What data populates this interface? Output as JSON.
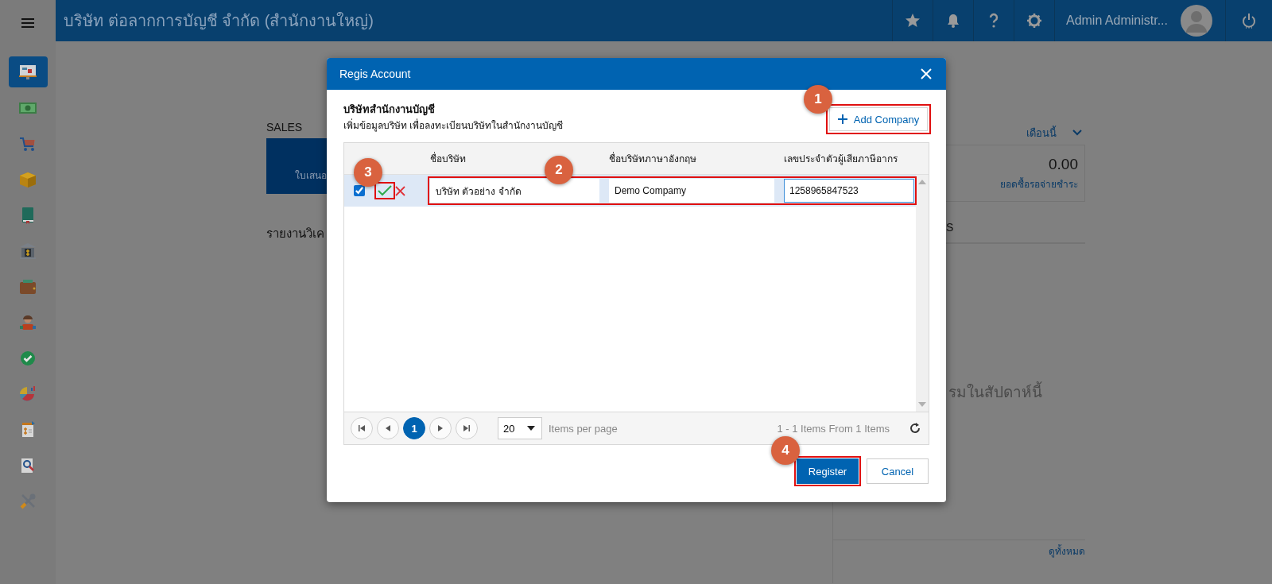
{
  "app_bar": {
    "title": "บริษัท ต่อลากการบัญชี จำกัด (สำนักงานใหญ่)",
    "user_name": "Admin Administr..."
  },
  "sidebar": {
    "items": [
      {
        "kind": "monitor",
        "selected": true
      },
      {
        "kind": "money",
        "selected": false
      },
      {
        "kind": "cart",
        "selected": false
      },
      {
        "kind": "box",
        "selected": false
      },
      {
        "kind": "book",
        "selected": false
      },
      {
        "kind": "bank",
        "selected": false
      },
      {
        "kind": "wallet",
        "selected": false
      },
      {
        "kind": "people",
        "selected": false
      },
      {
        "kind": "check",
        "selected": false
      },
      {
        "kind": "chart",
        "selected": false
      },
      {
        "kind": "invoice",
        "selected": false
      },
      {
        "kind": "search",
        "selected": false
      },
      {
        "kind": "tools",
        "selected": false
      }
    ]
  },
  "background": {
    "sales_label": "SALES",
    "tile_label": "ใบเสนอ",
    "report_heading": "รายงานวิเค",
    "period": "เดือนนี้",
    "stats": [
      {
        "value": "0.00",
        "label": "ยอดซื้อรอจ่ายชำระ"
      }
    ],
    "section_label": "S",
    "empty_message": "รมในสัปดาห์นี้",
    "view_all": "ดูทั้งหมด"
  },
  "dialog": {
    "title": "Regis Account",
    "heading": "บริษัทสำนักงานบัญชี",
    "subtitle": "เพิ่มข้อมูลบริษัท เพื่อลงทะเบียนบริษัทในสำนักงานบัญชี",
    "add_button": "Add Company",
    "table": {
      "columns": [
        "ชื่อบริษัท",
        "ชื่อบริษัทภาษาอังกฤษ",
        "เลขประจำตัวผู้เสียภาษีอากร"
      ],
      "rows": [
        {
          "checked": true,
          "selected": true,
          "cells": [
            {
              "value": "บริษัท ตัวอย่าง จำกัด",
              "focused": false
            },
            {
              "value": "Demo Compamy",
              "focused": false
            },
            {
              "value": "1258965847523",
              "focused": true
            }
          ]
        }
      ]
    },
    "pager": {
      "pages": [
        {
          "label": "1",
          "selected": true
        }
      ],
      "page_size": "20",
      "page_size_label": "Items per page",
      "summary": "1 - 1 Items From 1 Items"
    },
    "buttons": [
      {
        "label": "Register",
        "kind": "primary"
      },
      {
        "label": "Cancel",
        "kind": "secondary"
      }
    ]
  },
  "annotations": [
    {
      "label": "1"
    },
    {
      "label": "2"
    },
    {
      "label": "3"
    },
    {
      "label": "4"
    }
  ]
}
